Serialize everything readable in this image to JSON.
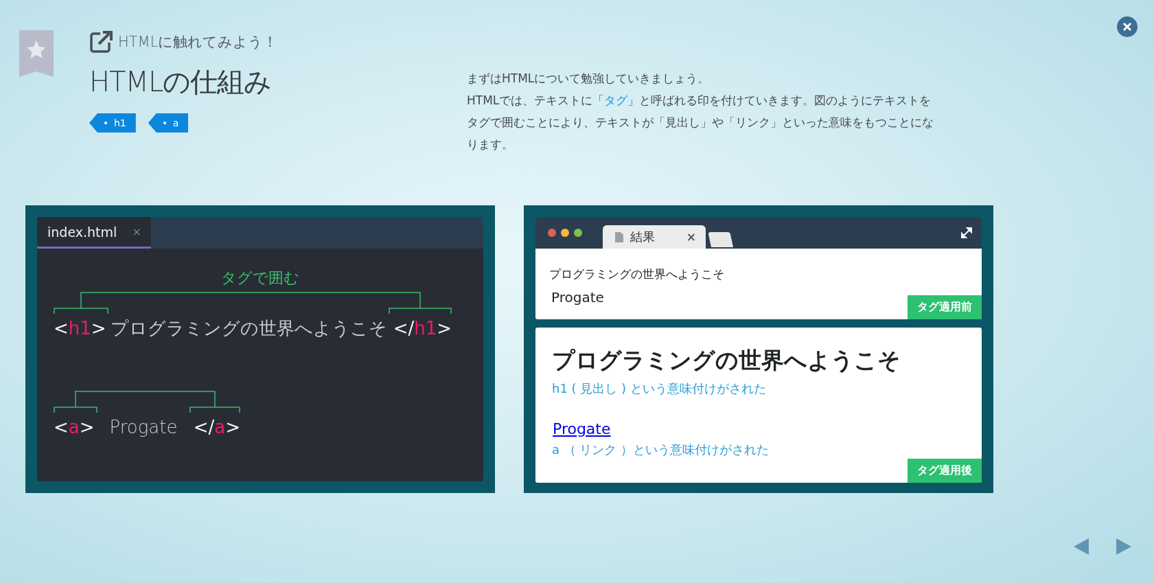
{
  "header": {
    "subtitle": "HTMLに触れてみよう！",
    "title": "HTMLの仕組み",
    "tags": [
      "h1",
      "a"
    ]
  },
  "description": {
    "lines": [
      [
        {
          "text": "まずはHTMLについて勉強していきましょう。",
          "highlight": false
        }
      ],
      [
        {
          "text": "HTMLでは、テキストに「",
          "highlight": false
        },
        {
          "text": "タグ",
          "highlight": true
        },
        {
          "text": "」と呼ばれる印を付けていきます。図のようにテキストをタグで囲むことにより、テキストが「見出し」や「リンク」といった意味をもつことになります。",
          "highlight": false
        }
      ]
    ]
  },
  "editor": {
    "tab": {
      "label": "index.html",
      "close": "×",
      "selected": true
    },
    "caption": "タグで囲む",
    "lines": [
      {
        "open": [
          "<",
          "h1",
          ">"
        ],
        "content": "プログラミングの世界へようこそ",
        "close": [
          "</",
          "h1",
          ">"
        ]
      },
      {
        "open": [
          "<",
          "a",
          ">"
        ],
        "content": "Progate",
        "close": [
          "</",
          "a",
          ">"
        ]
      }
    ]
  },
  "browser": {
    "dots": [
      {
        "color": "#e0604e"
      },
      {
        "color": "#f4b73d"
      },
      {
        "color": "#7cc24f"
      }
    ],
    "tab": {
      "label": "結果",
      "close": "×"
    },
    "before": {
      "lines": [
        "プログラミングの世界へようこそ",
        "Progate"
      ],
      "label": "タグ適用前"
    },
    "after": {
      "heading": "プログラミングの世界へようこそ",
      "heading_note": "h1 ( 見出し ) という意味付けがされた",
      "link": "Progate",
      "link_note": "a （ リンク ）という意味付けがされた",
      "label": "タグ適用後"
    }
  }
}
